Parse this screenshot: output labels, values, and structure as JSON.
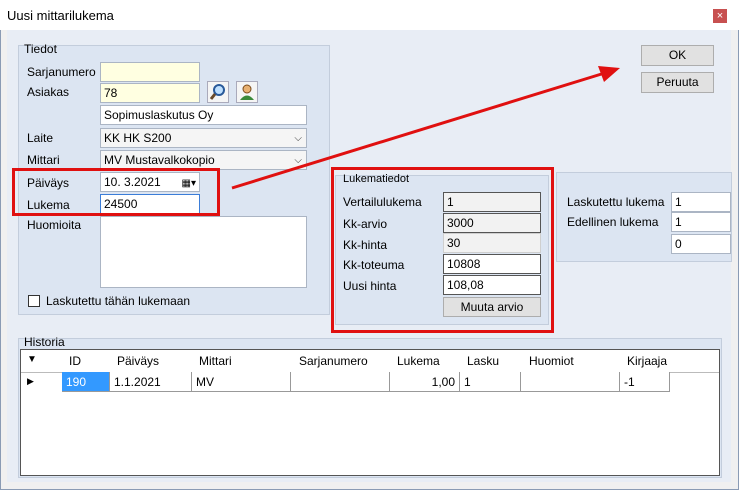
{
  "window": {
    "title": "Uusi mittarilukema",
    "close": "×"
  },
  "tiedot": {
    "legend": "Tiedot",
    "sarjanumero_label": "Sarjanumero",
    "sarjanumero_value": "",
    "asiakas_label": "Asiakas",
    "asiakas_value": "78",
    "asiakas_name": "Sopimuslaskutus Oy",
    "laite_label": "Laite",
    "laite_value": "KK  HK S200",
    "mittari_label": "Mittari",
    "mittari_value": "MV  Mustavalkokopio",
    "paivays_label": "Päiväys",
    "paivays_value": "10.  3.2021",
    "lukema_label": "Lukema",
    "lukema_value": "24500",
    "huomioita_label": "Huomioita",
    "huomioita_value": "",
    "checkbox_label": "Laskutettu tähän lukemaan"
  },
  "buttons": {
    "ok": "OK",
    "peruuta": "Peruuta",
    "muuta_arvio": "Muuta arvio"
  },
  "lukematiedot": {
    "legend": "Lukematiedot",
    "vertailulukema_label": "Vertailulukema",
    "vertailulukema_value": "1",
    "kk_arvio_label": "Kk-arvio",
    "kk_arvio_value": "3000",
    "kk_hinta_label": "Kk-hinta",
    "kk_hinta_value": "30",
    "kk_toteuma_label": "Kk-toteuma",
    "kk_toteuma_value": "10808",
    "uusi_hinta_label": "Uusi hinta",
    "uusi_hinta_value": "108,08"
  },
  "right": {
    "laskutettu_label": "Laskutettu lukema",
    "laskutettu_value": "1",
    "edellinen_label": "Edellinen lukema",
    "edellinen_value": "1",
    "extra_value": "0"
  },
  "historia": {
    "legend": "Historia",
    "filter_icon": "▼",
    "columns": [
      "ID",
      "Päiväys",
      "Mittari",
      "Sarjanumero",
      "Lukema",
      "Lasku",
      "Huomiot",
      "Kirjaaja"
    ],
    "row": {
      "id": "190",
      "paivays": "1.1.2021",
      "mittari": "MV",
      "sarjanumero": "",
      "lukema": "1,00",
      "lasku": "1",
      "huomiot": "",
      "kirjaaja": "-1"
    }
  },
  "colors": {
    "highlight": "#e01010",
    "selected_cell": "#3399ff"
  }
}
